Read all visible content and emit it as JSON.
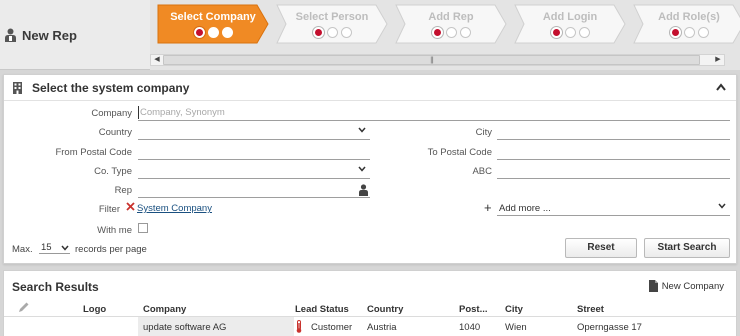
{
  "title": "New Rep",
  "steps": [
    {
      "label": "Select Company",
      "active": true,
      "dots": [
        true,
        false,
        false
      ]
    },
    {
      "label": "Select Person",
      "active": false,
      "dots": [
        true,
        false,
        false
      ]
    },
    {
      "label": "Add Rep",
      "active": false,
      "dots": [
        true,
        false,
        false
      ]
    },
    {
      "label": "Add Login",
      "active": false,
      "dots": [
        true,
        false,
        false
      ]
    },
    {
      "label": "Add Role(s)",
      "active": false,
      "dots": [
        true,
        false,
        false
      ]
    }
  ],
  "colors": {
    "accent": "#f08a24",
    "accent_dark": "#e2740e",
    "dot_red": "#c40f2e",
    "link": "#1a5080",
    "thermo_red": "#c9332e"
  },
  "panel": {
    "title": "Select the system company",
    "fields": {
      "company_label": "Company",
      "company_placeholder": "Company, Synonym",
      "country_label": "Country",
      "from_postal_label": "From Postal Code",
      "co_type_label": "Co. Type",
      "rep_label": "Rep",
      "filter_label": "Filter",
      "filter_value": "System Company",
      "with_me_label": "With me",
      "city_label": "City",
      "to_postal_label": "To Postal Code",
      "abc_label": "ABC",
      "add_more_label": "Add more ..."
    },
    "max_label": "Max.",
    "max_value": "15",
    "records_per_page": "records per page",
    "reset": "Reset",
    "start_search": "Start Search"
  },
  "results": {
    "title": "Search Results",
    "new_company": "New Company",
    "columns": {
      "logo": "Logo",
      "company": "Company",
      "lead_status": "Lead Status",
      "country": "Country",
      "postal": "Post...",
      "city": "City",
      "street": "Street"
    },
    "rows": [
      {
        "company": "update software AG",
        "lead_status": "Customer",
        "country": "Austria",
        "postal": "1040",
        "city": "Wien",
        "street": "Operngasse 17"
      }
    ]
  }
}
